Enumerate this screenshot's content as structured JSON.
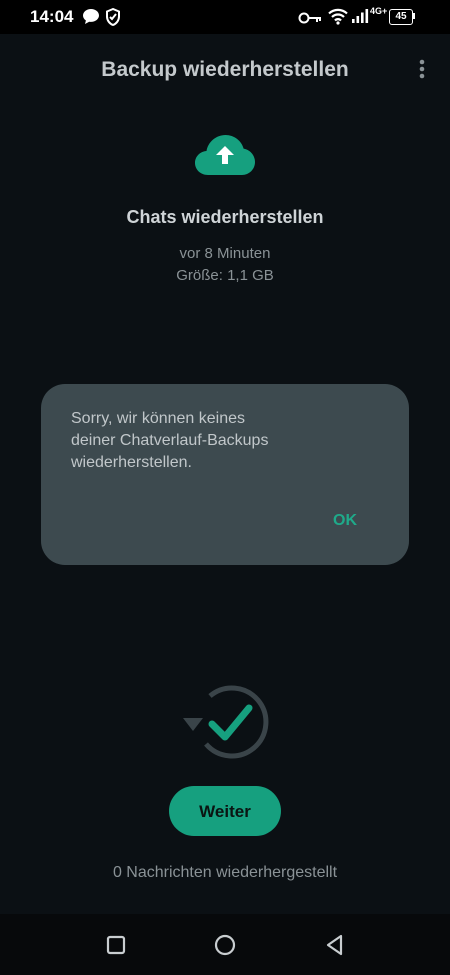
{
  "status_bar": {
    "time": "14:04",
    "network": "4G+",
    "battery": "45",
    "icons": [
      "chat-bubble-icon",
      "shield-icon",
      "vpn-key-icon",
      "wifi-icon",
      "signal-icon",
      "battery-icon"
    ]
  },
  "toolbar": {
    "title": "Backup wiederherstellen",
    "menu_icon": "more-vert-icon"
  },
  "backup": {
    "icon": "cloud-upload-icon",
    "title": "Chats wiederherstellen",
    "time_ago": "vor 8 Minuten",
    "size": "Größe: 1,1 GB"
  },
  "dialog": {
    "message_line1": "Sorry, wir können keines",
    "message_line2": "deiner Chatverlauf-Backups",
    "message_line3": "wiederherstellen.",
    "ok_label": "OK"
  },
  "restore": {
    "icon": "restore-check-icon",
    "button_label": "Weiter",
    "status": "0 Nachrichten wiederhergestellt"
  },
  "nav": {
    "buttons": [
      "recents-icon",
      "home-icon",
      "back-icon"
    ]
  },
  "colors": {
    "accent": "#16a07f",
    "background": "#0b1014",
    "dialog": "#3d4a4f"
  }
}
